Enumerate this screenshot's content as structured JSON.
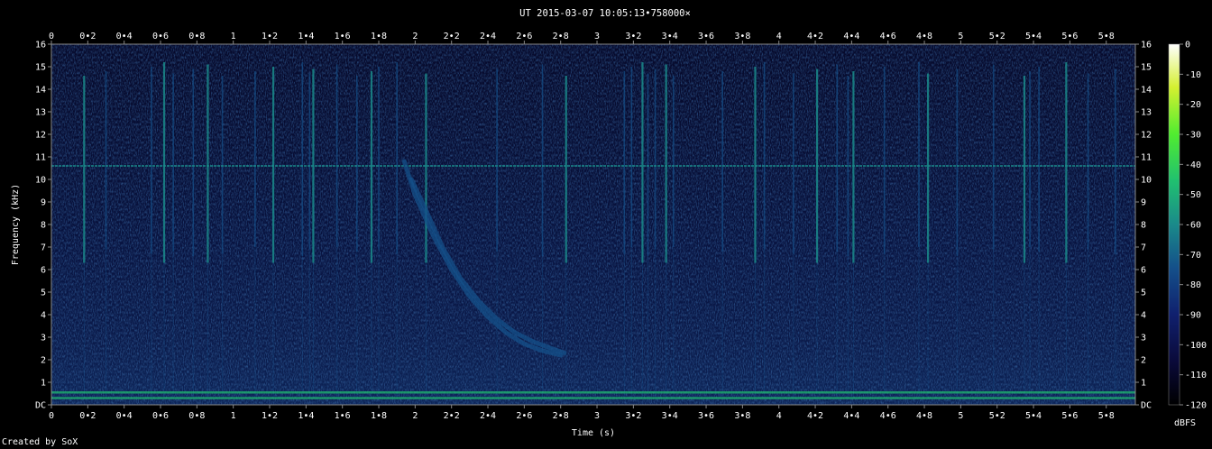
{
  "chart_data": {
    "type": "heatmap",
    "title": "UT 2015-03-07 10:05:13•758000×",
    "xlabel": "Time (s)",
    "ylabel": "Frequency (kHz)",
    "colorbar_label": "dBFS",
    "x_ticks": [
      "0",
      "0•2",
      "0•4",
      "0•6",
      "0•8",
      "1",
      "1•2",
      "1•4",
      "1•6",
      "1•8",
      "2",
      "2•2",
      "2•4",
      "2•6",
      "2•8",
      "3",
      "3•2",
      "3•4",
      "3•6",
      "3•8",
      "4",
      "4•2",
      "4•4",
      "4•6",
      "4•8",
      "5",
      "5•2",
      "5•4",
      "5•6",
      "5•8"
    ],
    "y_ticks": [
      "DC",
      "1",
      "2",
      "3",
      "4",
      "5",
      "6",
      "7",
      "8",
      "9",
      "10",
      "11",
      "12",
      "13",
      "14",
      "15",
      "16"
    ],
    "colorbar_ticks": [
      "0",
      "-10",
      "-20",
      "-30",
      "-40",
      "-50",
      "-60",
      "-70",
      "-80",
      "-90",
      "-100",
      "-110",
      "-120"
    ],
    "xlim": [
      0,
      5.96
    ],
    "ylim": [
      0,
      16
    ],
    "clim": [
      -120,
      0
    ],
    "colormap": [
      "#000000",
      "#0a0a3a",
      "#10206e",
      "#14508a",
      "#1a8a8a",
      "#20c070",
      "#50ec30",
      "#d4f030",
      "#ffffff"
    ],
    "persistent_tones_khz": [
      0.3,
      0.55,
      10.6
    ],
    "broadband_impulse_times_s": [
      0.18,
      0.3,
      0.55,
      0.62,
      0.67,
      0.78,
      0.86,
      0.94,
      1.12,
      1.22,
      1.38,
      1.42,
      1.44,
      1.57,
      1.68,
      1.76,
      1.8,
      1.9,
      2.06,
      2.45,
      2.7,
      2.83,
      3.15,
      3.19,
      3.25,
      3.28,
      3.32,
      3.38,
      3.42,
      3.69,
      3.87,
      3.92,
      4.08,
      4.21,
      4.32,
      4.38,
      4.41,
      4.58,
      4.77,
      4.82,
      4.98,
      5.18,
      5.35,
      5.38,
      5.43,
      5.58,
      5.7,
      5.85
    ],
    "whistler_curves": [
      {
        "times_s": [
          1.94,
          2.0,
          2.1,
          2.2,
          2.3,
          2.4,
          2.5,
          2.6,
          2.7,
          2.8
        ],
        "freqs_khz": [
          10.8,
          9.3,
          7.5,
          6.0,
          4.8,
          3.9,
          3.2,
          2.7,
          2.4,
          2.2
        ],
        "level_dbfs": -72
      },
      {
        "times_s": [
          1.98,
          2.05,
          2.15,
          2.25,
          2.35,
          2.45,
          2.55,
          2.65,
          2.75,
          2.82
        ],
        "freqs_khz": [
          10.0,
          8.8,
          7.0,
          5.6,
          4.6,
          3.8,
          3.2,
          2.8,
          2.5,
          2.3
        ],
        "level_dbfs": -82
      }
    ]
  },
  "credit": "Created by SoX"
}
